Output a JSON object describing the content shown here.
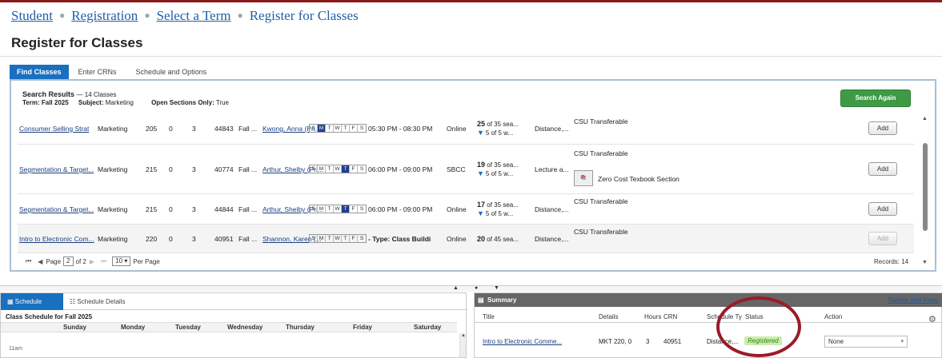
{
  "breadcrumb": [
    "Student",
    "Registration",
    "Select a Term",
    "Register for Classes"
  ],
  "page_title": "Register for Classes",
  "tabs": [
    "Find Classes",
    "Enter CRNs",
    "Schedule and Options"
  ],
  "search": {
    "title": "Search Results",
    "count": "— 14 Classes",
    "term_label": "Term:",
    "term_value": "Fall 2025",
    "subject_label": "Subject:",
    "subject_value": "Marketing",
    "open_label": "Open Sections Only:",
    "open_value": "True",
    "search_again": "Search Again"
  },
  "day_letters": [
    "S",
    "M",
    "T",
    "W",
    "T",
    "F",
    "S"
  ],
  "rows": [
    {
      "title": "Consumer Selling Strat",
      "subject": "Marketing",
      "course": "205",
      "section": "0",
      "hours": "3",
      "crn": "44843",
      "term": "Fall ...",
      "instructor": "Kwong, Anna (Pri...",
      "days_on": [
        1
      ],
      "time": "05:30 PM - 08:30 PM",
      "campus": "Online",
      "seats1": "25",
      "seats1_rest": " of 35 sea...",
      "seats2": "5 of 5 w...",
      "sched_type": "Distance,...",
      "attr1": "CSU Transferable",
      "attr2": "",
      "add": "Add",
      "add_enabled": true
    },
    {
      "title": "Segmentation & Target...",
      "subject": "Marketing",
      "course": "215",
      "section": "0",
      "hours": "3",
      "crn": "40774",
      "term": "Fall ...",
      "instructor": "Arthur, Shelby (Pri...",
      "days_on": [
        4
      ],
      "time": "06:00 PM - 09:00 PM",
      "campus": "SBCC",
      "seats1": "19",
      "seats1_rest": " of 35 sea...",
      "seats2": "5 of 5 w...",
      "sched_type": "Lecture a...",
      "attr1": "CSU Transferable",
      "attr2": "Zero Cost Texbook Section",
      "add": "Add",
      "add_enabled": true
    },
    {
      "title": "Segmentation & Target...",
      "subject": "Marketing",
      "course": "215",
      "section": "0",
      "hours": "3",
      "crn": "44844",
      "term": "Fall ...",
      "instructor": "Arthur, Shelby (Pri...",
      "days_on": [
        4
      ],
      "time": "06:00 PM - 09:00 PM",
      "campus": "Online",
      "seats1": "17",
      "seats1_rest": " of 35 sea...",
      "seats2": "5 of 5 w...",
      "sched_type": "Distance,...",
      "attr1": "CSU Transferable",
      "attr2": "",
      "add": "Add",
      "add_enabled": true
    },
    {
      "title": "Intro to Electronic Com...",
      "subject": "Marketing",
      "course": "220",
      "section": "0",
      "hours": "3",
      "crn": "40951",
      "term": "Fall ...",
      "instructor": "Shannon, Karen (...",
      "days_on": [],
      "time": "- Type: Class Buildi",
      "campus": "Online",
      "seats1": "20",
      "seats1_rest": " of 45 sea...",
      "seats2": "",
      "sched_type": "Distance,...",
      "attr1": "CSU Transferable",
      "attr2": "",
      "add": "Add",
      "add_enabled": false
    }
  ],
  "pager": {
    "page_label": "Page",
    "page": "2",
    "of_label": "of",
    "total": "2",
    "per_page": "10",
    "per_page_label": "Per Page",
    "records": "Records: 14"
  },
  "schedule": {
    "tab_schedule": "Schedule",
    "tab_details": "Schedule Details",
    "caption": "Class Schedule for Fall 2025",
    "days": [
      "Sunday",
      "Monday",
      "Tuesday",
      "Wednesday",
      "Thursday",
      "Friday",
      "Saturday"
    ],
    "time": "11am"
  },
  "summary": {
    "title": "Summary",
    "tuition": "Tuition and Fees",
    "headers": [
      "Title",
      "Details",
      "Hours",
      "CRN",
      "Schedule Ty",
      "Status",
      "Action"
    ],
    "row": {
      "title": "Intro to Electronic Comme...",
      "details": "MKT 220, 0",
      "hours": "3",
      "crn": "40951",
      "sched": "Distance,...",
      "status": "Registered",
      "action": "None"
    }
  },
  "colors": {
    "accent": "#1a6fbf",
    "green": "#3f9a45",
    "highlight": "#9b1b2a",
    "registered": "#c9efaa"
  }
}
